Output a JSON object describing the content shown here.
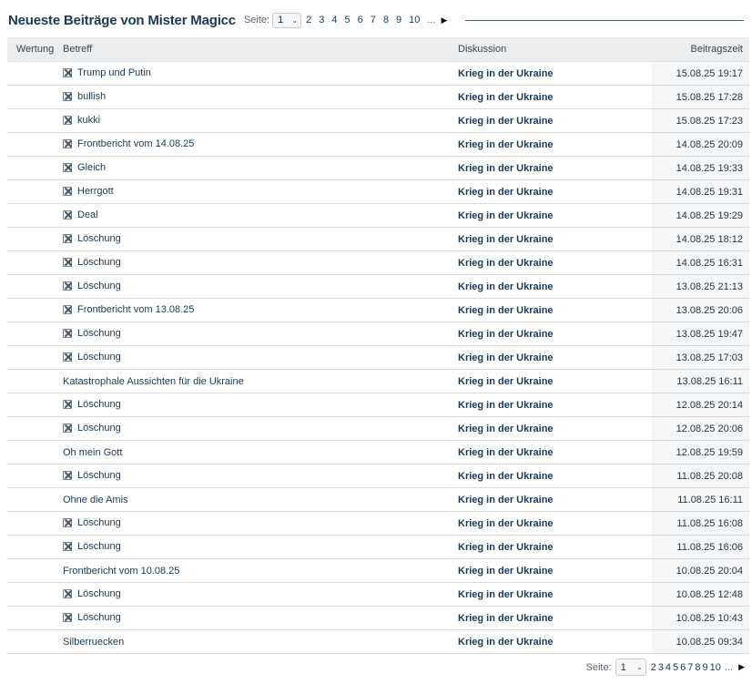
{
  "header": {
    "title": "Neueste Beiträge von Mister Magicc"
  },
  "pager": {
    "label": "Seite:",
    "selected": "1",
    "pages": [
      "2",
      "3",
      "4",
      "5",
      "6",
      "7",
      "8",
      "9",
      "10"
    ],
    "ellipsis": "...",
    "next_icon": "triangle-right-icon"
  },
  "table": {
    "columns": {
      "rating": "Wertung",
      "subject": "Betreff",
      "discussion": "Diskussion",
      "time": "Beitragszeit"
    },
    "rows": [
      {
        "deleted": true,
        "subject": "Trump und Putin",
        "discussion": "Krieg in der Ukraine",
        "time": "15.08.25 19:17"
      },
      {
        "deleted": true,
        "subject": "bullish",
        "discussion": "Krieg in der Ukraine",
        "time": "15.08.25 17:28"
      },
      {
        "deleted": true,
        "subject": "kukki",
        "discussion": "Krieg in der Ukraine",
        "time": "15.08.25 17:23"
      },
      {
        "deleted": true,
        "subject": "Frontbericht vom 14.08.25",
        "discussion": "Krieg in der Ukraine",
        "time": "14.08.25 20:09"
      },
      {
        "deleted": true,
        "subject": "Gleich",
        "discussion": "Krieg in der Ukraine",
        "time": "14.08.25 19:33"
      },
      {
        "deleted": true,
        "subject": "Herrgott",
        "discussion": "Krieg in der Ukraine",
        "time": "14.08.25 19:31"
      },
      {
        "deleted": true,
        "subject": "Deal",
        "discussion": "Krieg in der Ukraine",
        "time": "14.08.25 19:29"
      },
      {
        "deleted": true,
        "subject": "Löschung",
        "discussion": "Krieg in der Ukraine",
        "time": "14.08.25 18:12"
      },
      {
        "deleted": true,
        "subject": "Löschung",
        "discussion": "Krieg in der Ukraine",
        "time": "14.08.25 16:31"
      },
      {
        "deleted": true,
        "subject": "Löschung",
        "discussion": "Krieg in der Ukraine",
        "time": "13.08.25 21:13"
      },
      {
        "deleted": true,
        "subject": "Frontbericht vom 13.08.25",
        "discussion": "Krieg in der Ukraine",
        "time": "13.08.25 20:06"
      },
      {
        "deleted": true,
        "subject": "Löschung",
        "discussion": "Krieg in der Ukraine",
        "time": "13.08.25 19:47"
      },
      {
        "deleted": true,
        "subject": "Löschung",
        "discussion": "Krieg in der Ukraine",
        "time": "13.08.25 17:03"
      },
      {
        "deleted": false,
        "subject": "Katastrophale Aussichten für die Ukraine",
        "discussion": "Krieg in der Ukraine",
        "time": "13.08.25 16:11"
      },
      {
        "deleted": true,
        "subject": "Löschung",
        "discussion": "Krieg in der Ukraine",
        "time": "12.08.25 20:14"
      },
      {
        "deleted": true,
        "subject": "Löschung",
        "discussion": "Krieg in der Ukraine",
        "time": "12.08.25 20:06"
      },
      {
        "deleted": false,
        "subject": "Oh mein Gott",
        "discussion": "Krieg in der Ukraine",
        "time": "12.08.25 19:59"
      },
      {
        "deleted": true,
        "subject": "Löschung",
        "discussion": "Krieg in der Ukraine",
        "time": "11.08.25 20:08"
      },
      {
        "deleted": false,
        "subject": "Ohne die Amis",
        "discussion": "Krieg in der Ukraine",
        "time": "11.08.25 16:11"
      },
      {
        "deleted": true,
        "subject": "Löschung",
        "discussion": "Krieg in der Ukraine",
        "time": "11.08.25 16:08"
      },
      {
        "deleted": true,
        "subject": "Löschung",
        "discussion": "Krieg in der Ukraine",
        "time": "11.08.25 16:06"
      },
      {
        "deleted": false,
        "subject": "Frontbericht vom 10.08.25",
        "discussion": "Krieg in der Ukraine",
        "time": "10.08.25 20:04"
      },
      {
        "deleted": true,
        "subject": "Löschung",
        "discussion": "Krieg in der Ukraine",
        "time": "10.08.25 12:48"
      },
      {
        "deleted": true,
        "subject": "Löschung",
        "discussion": "Krieg in der Ukraine",
        "time": "10.08.25 10:43"
      },
      {
        "deleted": false,
        "subject": "Silberruecken",
        "discussion": "Krieg in der Ukraine",
        "time": "10.08.25 09:34"
      }
    ]
  },
  "colors": {
    "title": "#1a3a55",
    "link": "#1a3a55",
    "header_bg": "#ecedef"
  }
}
